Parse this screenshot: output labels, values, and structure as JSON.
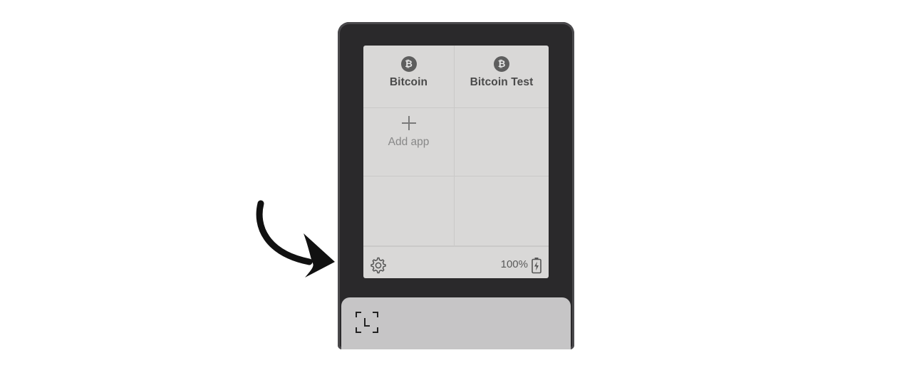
{
  "apps": [
    {
      "label": "Bitcoin",
      "icon": "bitcoin-icon"
    },
    {
      "label": "Bitcoin Test",
      "icon": "bitcoin-icon"
    }
  ],
  "add_app": {
    "label": "Add app",
    "icon": "plus-icon"
  },
  "status": {
    "settings_icon": "gear-icon",
    "battery_text": "100%",
    "battery_icon": "battery-charging-icon"
  },
  "bottom": {
    "icon": "scan-icon"
  },
  "annotation": {
    "icon": "curved-arrow-icon"
  },
  "colors": {
    "device_body": "#2a292b",
    "screen": "#d9d8d7",
    "bottom_panel": "#c6c5c6"
  }
}
